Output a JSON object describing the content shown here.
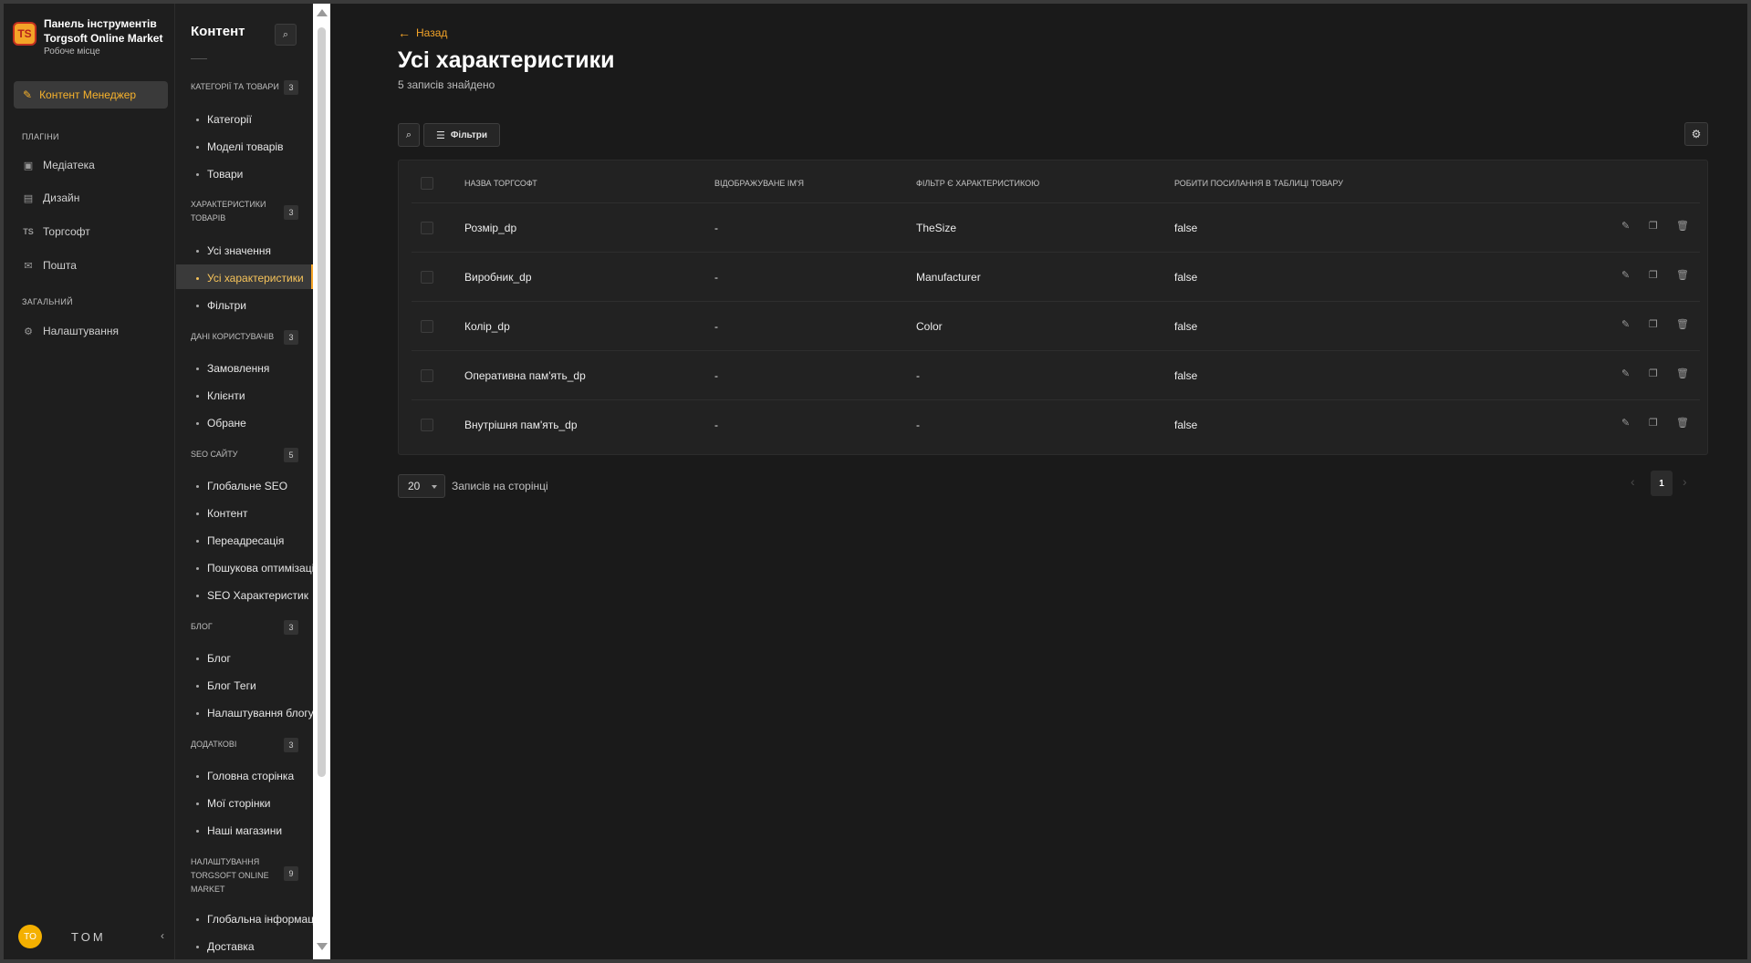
{
  "brand": {
    "logo_text": "TS",
    "line1": "Панель інструментів",
    "line2": "Torgsoft Online Market",
    "line3": "Робоче місце"
  },
  "sidebar": {
    "active_item": "Контент Менеджер",
    "section_plugins": "ПЛАГІНИ",
    "plugins": [
      "Медіатека",
      "Дизайн",
      "Торгсофт",
      "Пошта"
    ],
    "section_general": "ЗАГАЛЬНИЙ",
    "general": [
      "Налаштування"
    ],
    "user_initials": "TO",
    "user_name": "TOM"
  },
  "panel": {
    "title": "Контент",
    "groups": [
      {
        "label": "КАТЕГОРІЇ ТА ТОВАРИ",
        "count": "3",
        "items": [
          "Категорії",
          "Моделі товарів",
          "Товари"
        ]
      },
      {
        "label": "ХАРАКТЕРИСТИКИ ТОВАРІВ",
        "count": "3",
        "items": [
          "Усі значення",
          "Усі характеристики",
          "Фільтри"
        ]
      },
      {
        "label": "ДАНІ КОРИСТУВАЧІВ",
        "count": "3",
        "items": [
          "Замовлення",
          "Клієнти",
          "Обране"
        ]
      },
      {
        "label": "SEO САЙТУ",
        "count": "5",
        "items": [
          "Глобальне SEO",
          "Контент",
          "Переадресація",
          "Пошукова оптимізація",
          "SEO Характеристик"
        ]
      },
      {
        "label": "БЛОГ",
        "count": "3",
        "items": [
          "Блог",
          "Блог Теги",
          "Налаштування блогу"
        ]
      },
      {
        "label": "ДОДАТКОВІ",
        "count": "3",
        "items": [
          "Головна сторінка",
          "Мої сторінки",
          "Наші магазини"
        ]
      },
      {
        "label": "НАЛАШТУВАННЯ TORGSOFT ONLINE MARKET",
        "count": "9",
        "items": [
          "Глобальна інформація",
          "Доставка"
        ]
      }
    ]
  },
  "main": {
    "back_label": "Назад",
    "title": "Усі характеристики",
    "subtitle": "5 записів знайдено",
    "filter_label": "Фільтри",
    "columns": [
      "НАЗВА ТОРГСОФТ",
      "ВІДОБРАЖУВАНЕ ІМ'Я",
      "ФІЛЬТР Є ХАРАКТЕРИСТИКОЮ",
      "РОБИТИ ПОСИЛАННЯ В ТАБЛИЦІ ТОВАРУ"
    ],
    "rows": [
      {
        "name": "Розмір_dp",
        "display": "-",
        "filter": "TheSize",
        "link": "false"
      },
      {
        "name": "Виробник_dp",
        "display": "-",
        "filter": "Manufacturer",
        "link": "false"
      },
      {
        "name": "Колір_dp",
        "display": "-",
        "filter": "Color",
        "link": "false"
      },
      {
        "name": "Оперативна пам'ять_dp",
        "display": "-",
        "filter": "-",
        "link": "false"
      },
      {
        "name": "Внутрішня пам'ять_dp",
        "display": "-",
        "filter": "-",
        "link": "false"
      }
    ],
    "per_page_value": "20",
    "per_page_label": "Записів на сторінці",
    "current_page": "1"
  },
  "colors": {
    "accent": "#f4a428",
    "background": "#1a1a1a"
  }
}
